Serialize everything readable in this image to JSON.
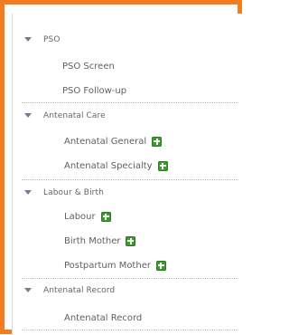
{
  "groups": [
    {
      "label": "PSO",
      "items": [
        {
          "label": "PSO Screen"
        },
        {
          "label": "PSO Follow-up"
        }
      ]
    },
    {
      "label": "Antenatal Care",
      "items": [
        {
          "label": "Antenatal General"
        },
        {
          "label": "Antenatal Specialty"
        }
      ]
    },
    {
      "label": "Labour & Birth",
      "items": [
        {
          "label": "Labour"
        },
        {
          "label": "Birth Mother"
        },
        {
          "label": "Postpartum Mother"
        }
      ]
    },
    {
      "label": "Antenatal Record",
      "items": [
        {
          "label": "Antenatal Record"
        }
      ]
    }
  ],
  "colors": {
    "frame_border": "#f07d1f",
    "add_button": "#3c9b2e"
  }
}
